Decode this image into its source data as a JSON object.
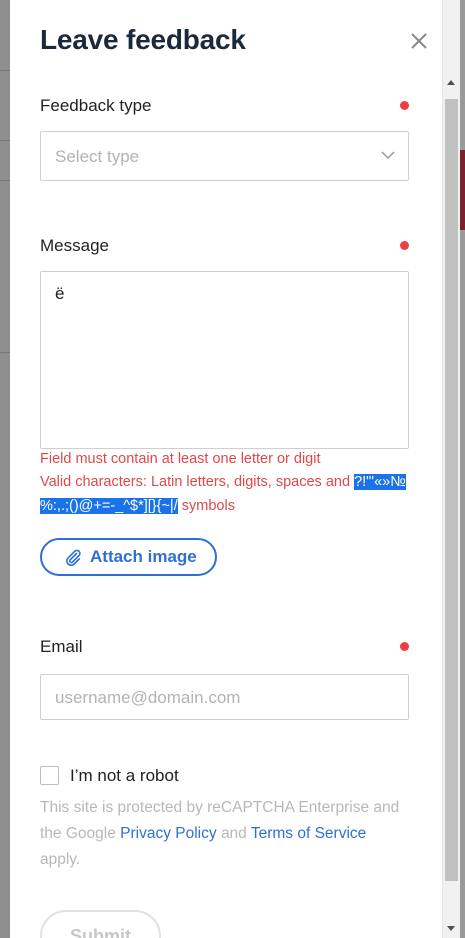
{
  "modal": {
    "title": "Leave feedback",
    "feedback_type": {
      "label": "Feedback type",
      "placeholder": "Select type"
    },
    "message": {
      "label": "Message",
      "value": "ё",
      "error_1": "Field must contain at least one letter or digit",
      "error_2_prefix": "Valid characters: Latin letters, digits, spaces and",
      "error_2_hl_line1": "?!\"'«»№",
      "error_2_hl_line2": "%:,.;()@+=-_^$*][}{~|/",
      "error_2_suffix": "symbols"
    },
    "attach_label": "Attach image",
    "email": {
      "label": "Email",
      "placeholder": "username@domain.com"
    },
    "captcha": {
      "label": "I’m not a robot",
      "note_part1": "This site is protected by reCAPTCHA Enterprise and the Google",
      "privacy_link": "Privacy Policy",
      "and": "and",
      "terms_link": "Terms of Service",
      "apply": "apply."
    },
    "submit_label": "Submit"
  },
  "colors": {
    "accent": "#2f6fd6",
    "error": "#e04848",
    "required_dot": "#ef3e42",
    "title": "#1b2a3a"
  },
  "icons": [
    "close-icon",
    "chevron-down-icon",
    "paperclip-icon"
  ]
}
